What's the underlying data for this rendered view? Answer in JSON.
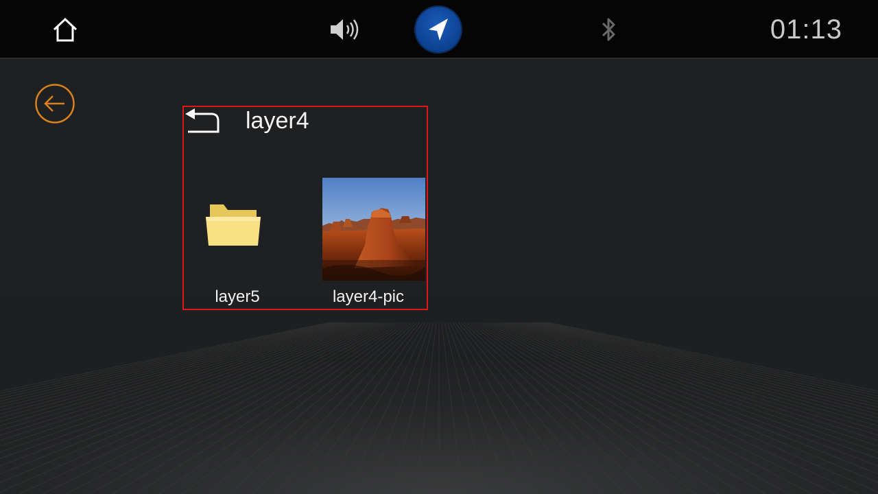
{
  "statusbar": {
    "home_icon": "home-icon",
    "volume_icon": "volume-icon",
    "navigation_icon": "navigation-arrow-icon",
    "bluetooth_icon": "bluetooth-icon",
    "clock": "01:13"
  },
  "back_icon": "circle-arrow-left-icon",
  "browser": {
    "up_icon": "return-arrow-icon",
    "title": "layer4",
    "items": [
      {
        "type": "folder",
        "icon": "folder-icon",
        "label": "layer5"
      },
      {
        "type": "image",
        "icon": "image-thumbnail",
        "label": "layer4-pic"
      }
    ]
  },
  "colors": {
    "background": "#1e1f20",
    "statusbar": "#050505",
    "accent_back": "#d9821f",
    "nav_blue": "#0c3f8e",
    "selection_border": "#e0161a",
    "folder_yellow": "#f6dd7a",
    "text": "#f5f5f5",
    "clock_text": "#c9c9c9"
  }
}
